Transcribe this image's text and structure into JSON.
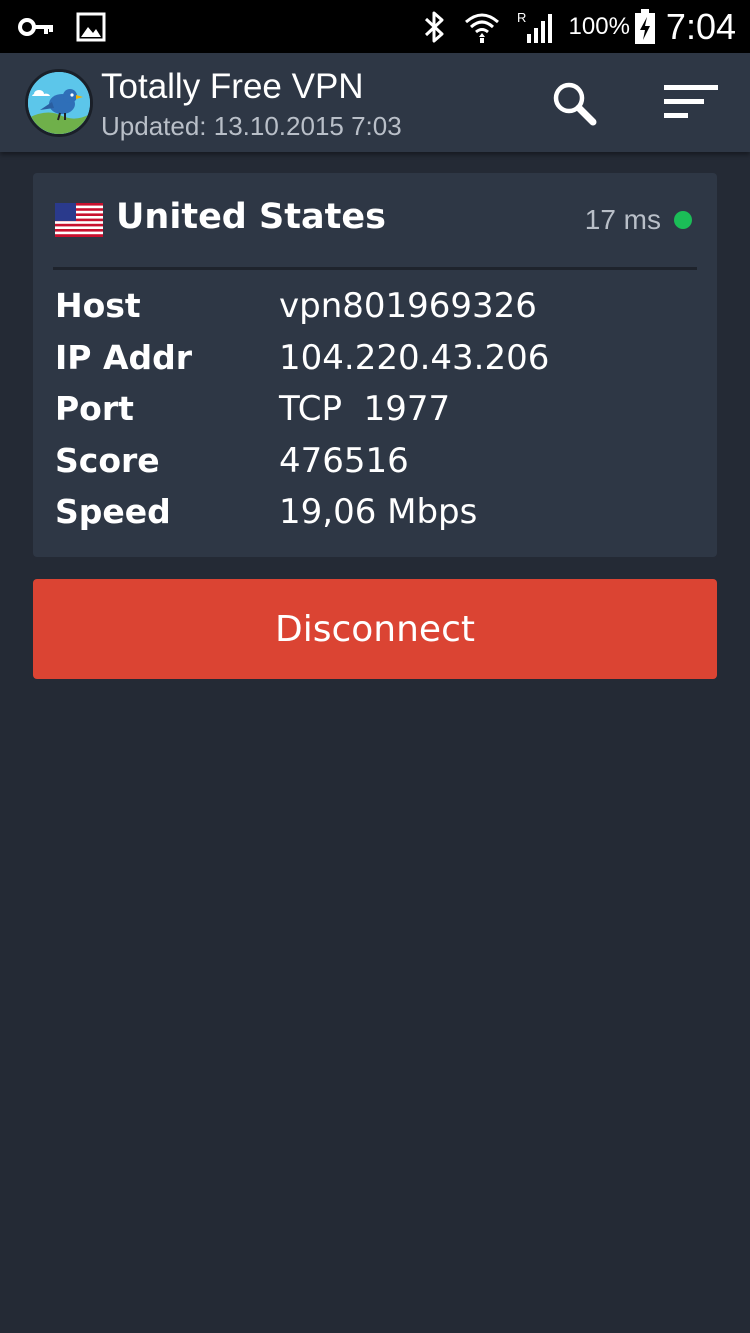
{
  "status_bar": {
    "battery_percent": "100%",
    "time": "7:04",
    "icons": [
      "vpn-key-icon",
      "gallery-icon",
      "bluetooth-icon",
      "wifi-icon",
      "signal-icon",
      "battery-charging-icon"
    ]
  },
  "app_bar": {
    "title": "Totally Free VPN",
    "subtitle": "Updated: 13.10.2015 7:03",
    "logo_icon": "bird-logo-icon",
    "search_icon": "search-icon",
    "menu_icon": "sort-menu-icon"
  },
  "server": {
    "flag_icon": "us-flag-icon",
    "country": "United States",
    "ping": "17 ms",
    "status_color": "#1bbd57",
    "rows": [
      {
        "label": "Host",
        "value": "vpn801969326"
      },
      {
        "label": "IP Addr",
        "value": "104.220.43.206"
      },
      {
        "label": "Port",
        "value": "TCP  1977"
      },
      {
        "label": "Score",
        "value": "476516"
      },
      {
        "label": "Speed",
        "value": "19,06 Mbps"
      }
    ]
  },
  "actions": {
    "disconnect_label": "Disconnect",
    "disconnect_color": "#db4433"
  }
}
